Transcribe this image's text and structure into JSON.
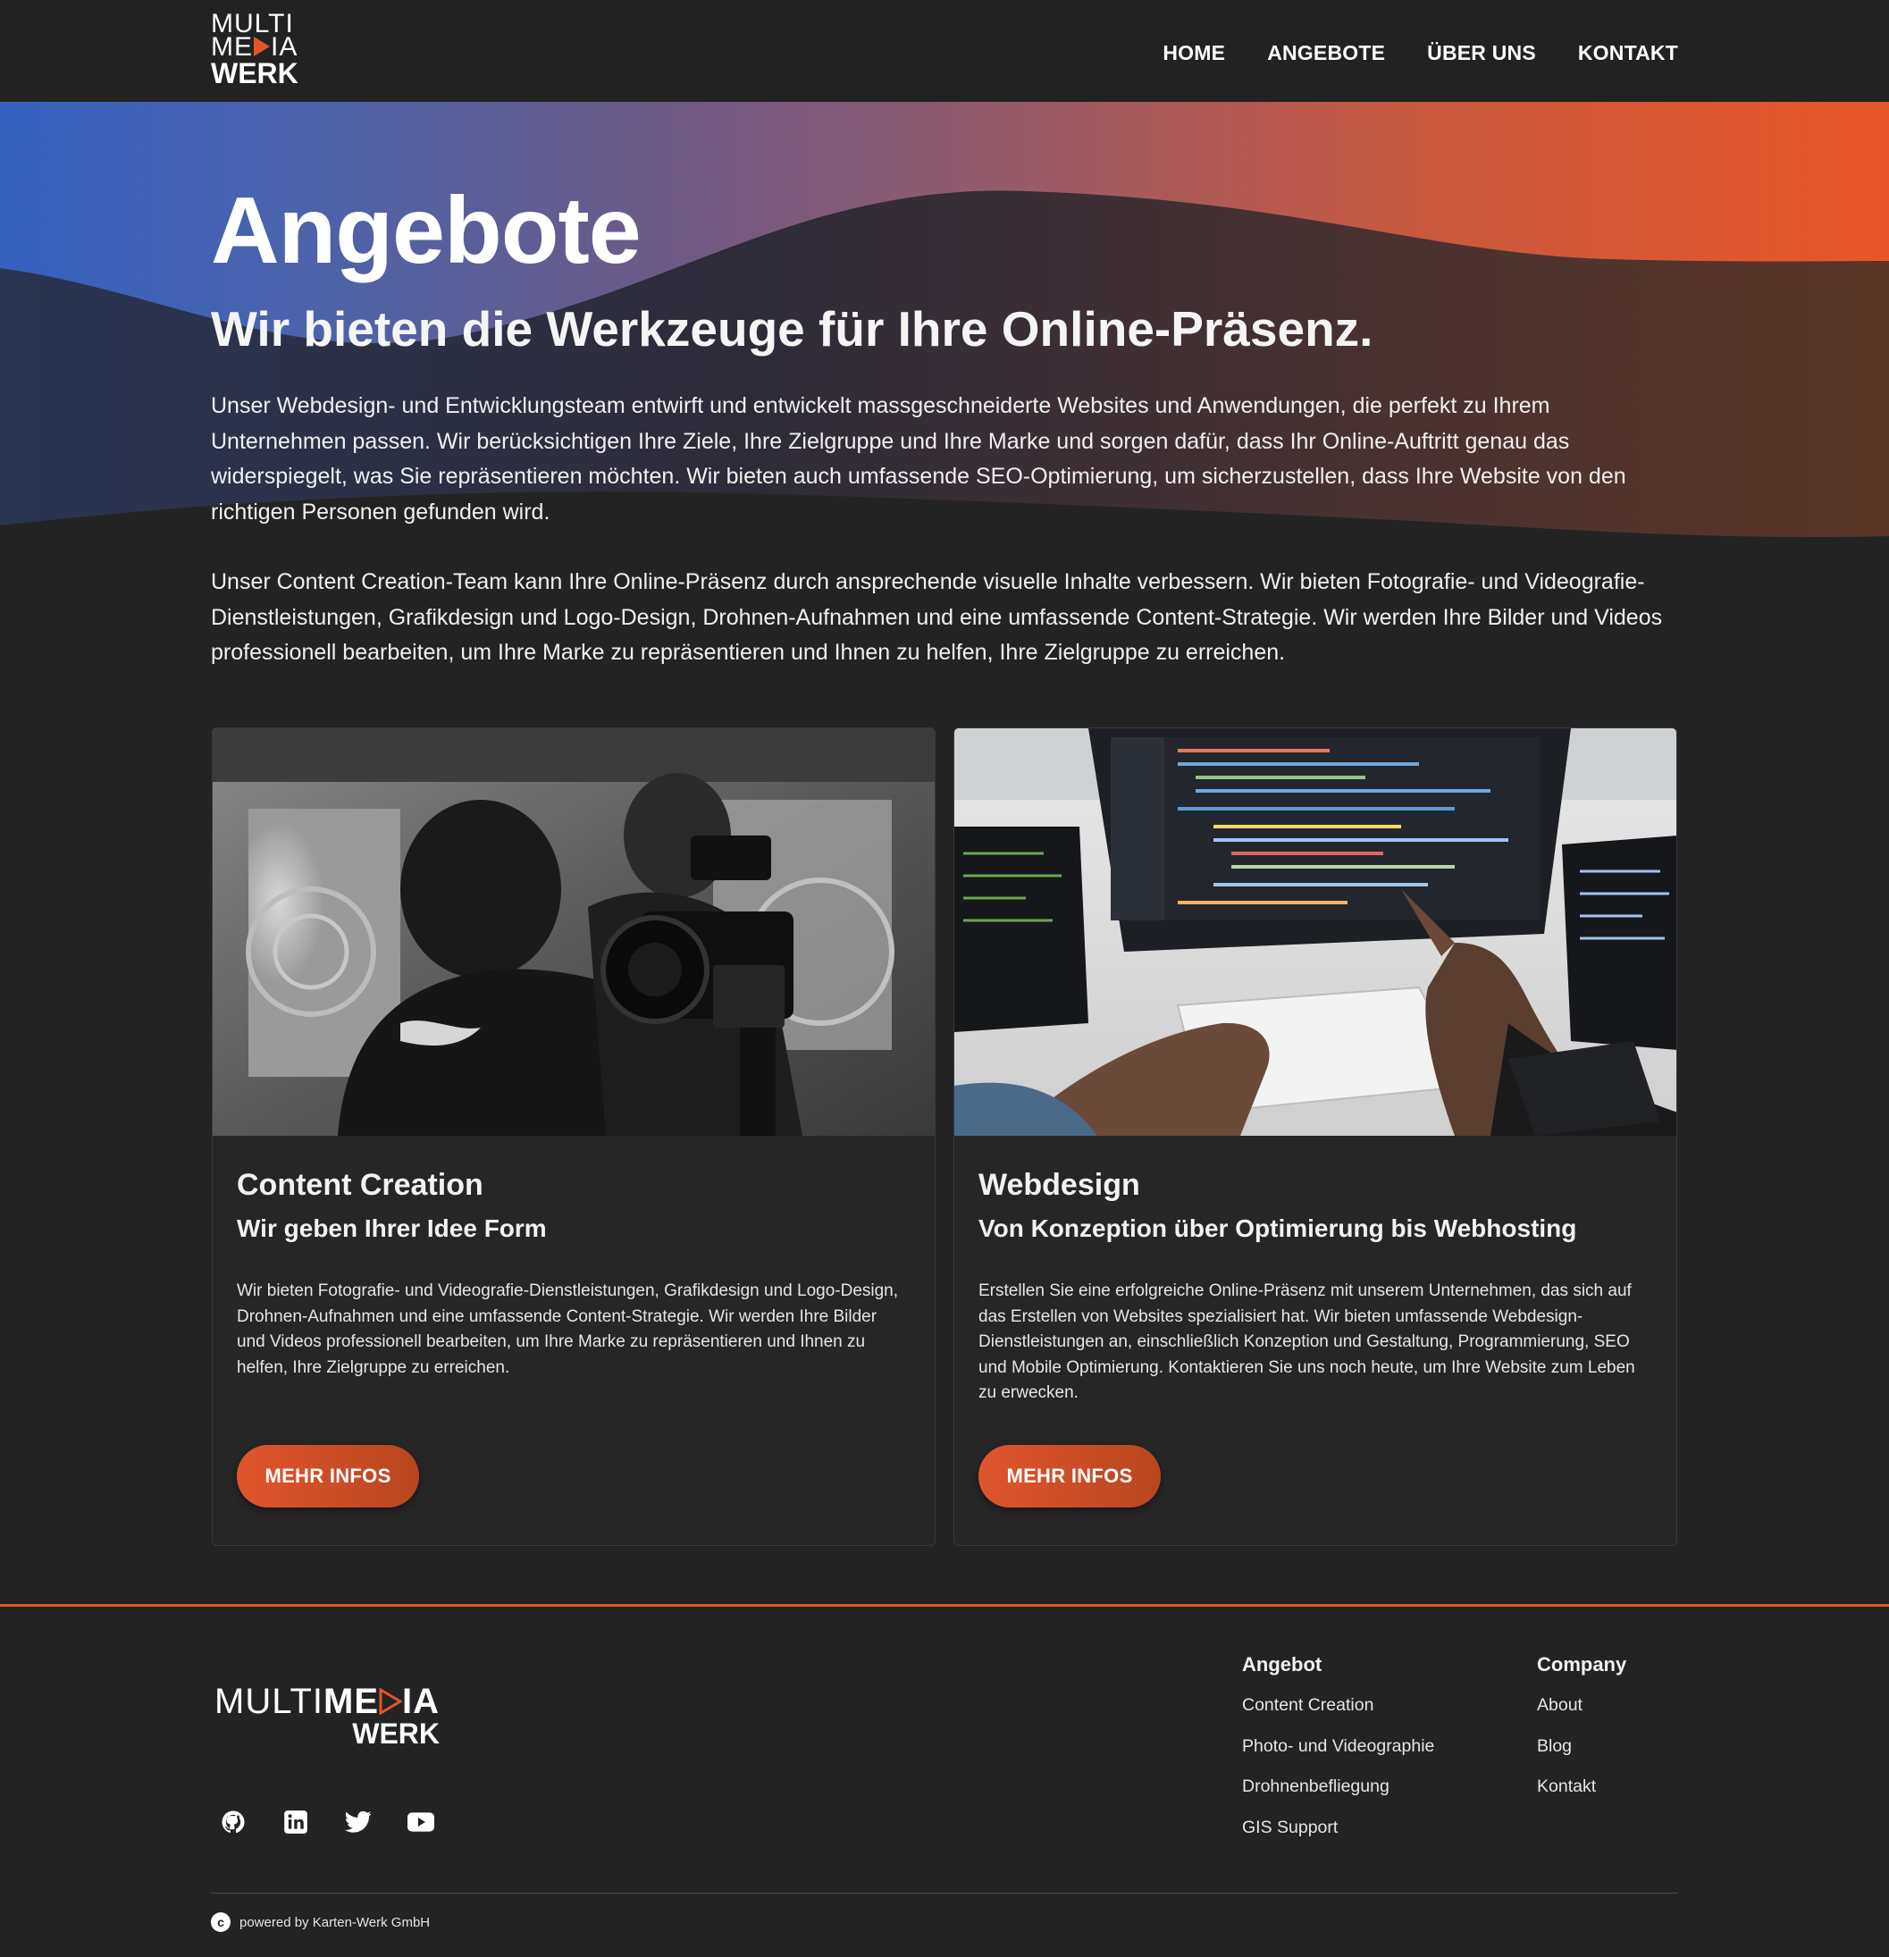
{
  "header": {
    "logo": {
      "line1": "MULTI",
      "line2_a": "ME",
      "line2_b": "IA",
      "line3": "WERK"
    },
    "nav": [
      {
        "label": "HOME"
      },
      {
        "label": "ANGEBOTE"
      },
      {
        "label": "ÜBER UNS"
      },
      {
        "label": "KONTAKT"
      }
    ]
  },
  "hero": {
    "title": "Angebote",
    "subtitle": "Wir bieten die Werkzeuge für Ihre Online-Präsenz.",
    "paragraph1": "Unser Webdesign- und Entwicklungsteam entwirft und entwickelt massgeschneiderte Websites und Anwendungen, die perfekt zu Ihrem Unternehmen passen. Wir berücksichtigen Ihre Ziele, Ihre Zielgruppe und Ihre Marke und sorgen dafür, dass Ihr Online-Auftritt genau das widerspiegelt, was Sie repräsentieren möchten. Wir bieten auch umfassende SEO-Optimierung, um sicherzustellen, dass Ihre Website von den richtigen Personen gefunden wird.",
    "paragraph2": "Unser Content Creation-Team kann Ihre Online-Präsenz durch ansprechende visuelle Inhalte verbessern. Wir bieten Fotografie- und Videografie-Dienstleistungen, Grafikdesign und Logo-Design, Drohnen-Aufnahmen und eine umfassende Content-Strategie. Wir werden Ihre Bilder und Videos professionell bearbeiten, um Ihre Marke zu repräsentieren und Ihnen zu helfen, Ihre Zielgruppe zu erreichen.",
    "gradient_colors": [
      "#3b66c4",
      "#e2552a"
    ]
  },
  "cards": [
    {
      "title": "Content Creation",
      "subtitle": "Wir geben Ihrer Idee Form",
      "text": "Wir bieten Fotografie- und Videografie-Dienstleistungen, Grafikdesign und Logo-Design, Drohnen-Aufnahmen und eine umfassende Content-Strategie. Wir werden Ihre Bilder und Videos professionell bearbeiten, um Ihre Marke zu repräsentieren und Ihnen zu helfen, Ihre Zielgruppe zu erreichen.",
      "button": "MEHR INFOS",
      "image": "camera-photo"
    },
    {
      "title": "Webdesign",
      "subtitle": "Von Konzeption über Optimierung bis Webhosting",
      "text": "Erstellen Sie eine erfolgreiche Online-Präsenz mit unserem Unternehmen, das sich auf das Erstellen von Websites spezialisiert hat. Wir bieten umfassende Webdesign-Dienstleistungen an, einschließlich Konzeption und Gestaltung, Programmierung, SEO und Mobile Optimierung. Kontaktieren Sie uns noch heute, um Ihre Website zum Leben zu erwecken.",
      "button": "MEHR INFOS",
      "image": "coding-workspace-photo"
    }
  ],
  "footer": {
    "logo": {
      "multi": "MULTI",
      "me": "ME",
      "ia": "IA",
      "werk": "WERK"
    },
    "social": [
      "github-icon",
      "linkedin-icon",
      "twitter-icon",
      "youtube-icon"
    ],
    "columns": [
      {
        "title": "Angebot",
        "links": [
          "Content Creation",
          "Photo- und Videographie",
          "Drohnenbefliegung",
          "GIS Support"
        ]
      },
      {
        "title": "Company",
        "links": [
          "About",
          "Blog",
          "Kontakt"
        ]
      }
    ],
    "copyright": "powered by Karten-Werk GmbH",
    "copyright_symbol": "c",
    "accent": "#e2552a"
  }
}
